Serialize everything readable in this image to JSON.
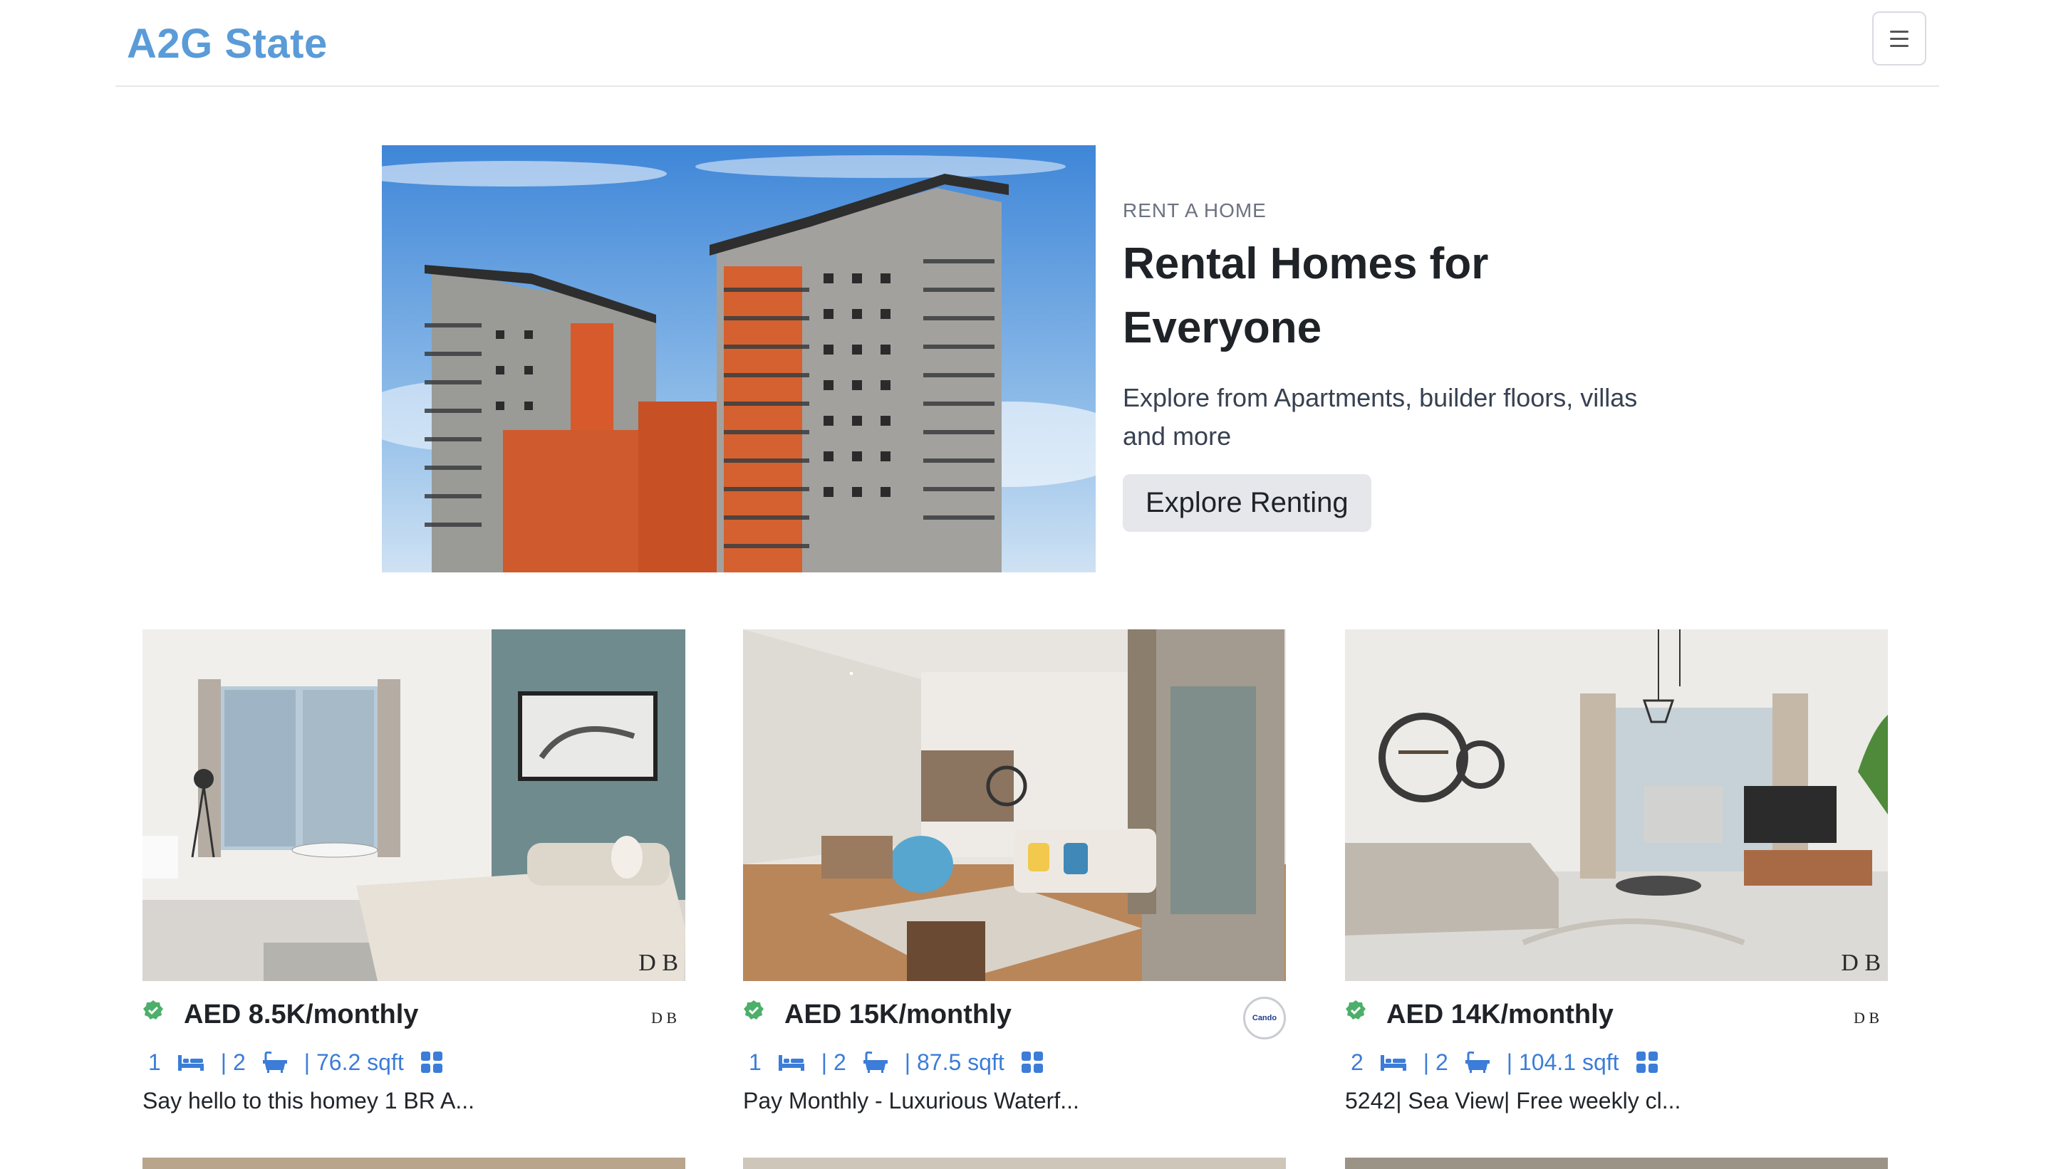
{
  "navbar": {
    "brand": "A2G State"
  },
  "hero": {
    "eyebrow": "RENT A HOME",
    "title_line1": "Rental Homes for",
    "title_line2": "Everyone",
    "subtitle_line1": "Explore from Apartments, builder floors, villas",
    "subtitle_line2": "and more",
    "cta": "Explore Renting"
  },
  "listings": [
    {
      "price": "AED 8.5K/monthly",
      "beds": "1",
      "baths": "| 2",
      "area": "| 76.2 sqft",
      "description": "Say hello to this homey 1 BR A...",
      "agency_logo_text": "D B",
      "watermark": "D B"
    },
    {
      "price": "AED 15K/monthly",
      "beds": "1",
      "baths": "| 2",
      "area": "| 87.5 sqft",
      "description": "Pay Monthly - Luxurious Waterf...",
      "agency_logo_text": "Cando",
      "watermark": ""
    },
    {
      "price": "AED 14K/monthly",
      "beds": "2",
      "baths": "| 2",
      "area": "| 104.1 sqft",
      "description": "5242| Sea View| Free weekly cl...",
      "agency_logo_text": "D B",
      "watermark": "D B"
    }
  ],
  "colors": {
    "brand": "#5a9bd8",
    "spec_blue": "#3b7dd8",
    "verified_green": "#4caf6a",
    "button_bg": "#e5e7eb"
  },
  "icons": [
    "menu-icon",
    "verified-icon",
    "bed-icon",
    "bath-icon",
    "grid-icon"
  ]
}
